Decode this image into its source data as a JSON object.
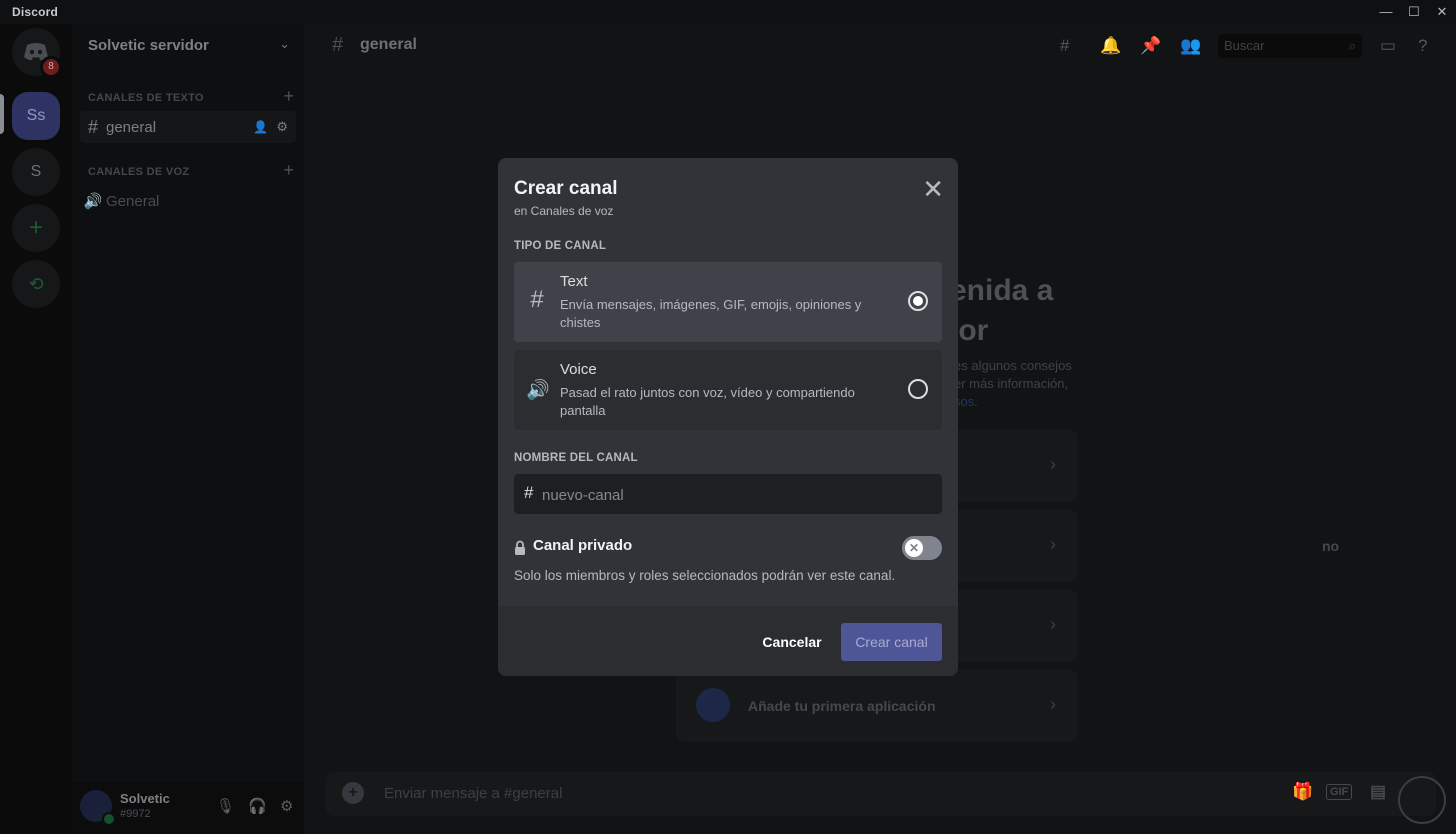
{
  "window": {
    "app_name": "Discord",
    "controls": [
      "—",
      "☐",
      "✕"
    ]
  },
  "guilds": [
    {
      "label": "",
      "badge": "8"
    },
    {
      "label": "Ss"
    },
    {
      "label": "S"
    },
    {
      "label": "+"
    },
    {
      "label": "⟲"
    }
  ],
  "sidebar": {
    "server_name": "Solvetic servidor",
    "text_category": "CANALES DE TEXTO",
    "voice_category": "CANALES DE VOZ",
    "text_channel": "general",
    "voice_channel": "General"
  },
  "user": {
    "name": "Solvetic",
    "tag": "#9972"
  },
  "topbar": {
    "channel": "general",
    "search_placeholder": "Buscar"
  },
  "welcome": {
    "line1": "enida a",
    "line2": "lor",
    "desc1": "es algunos consejos",
    "desc2": "er más información,",
    "desc3": "sos."
  },
  "cards": [
    {
      "label": ""
    },
    {
      "label": "no"
    },
    {
      "label": ""
    },
    {
      "label": "Añade tu primera aplicación"
    }
  ],
  "composer": {
    "placeholder": "Enviar mensaje a #general",
    "gif": "GIF"
  },
  "modal": {
    "title": "Crear canal",
    "subtitle": "en Canales de voz",
    "type_label": "TIPO DE CANAL",
    "options": [
      {
        "title": "Text",
        "desc": "Envía mensajes, imágenes, GIF, emojis, opiniones y chistes",
        "selected": true
      },
      {
        "title": "Voice",
        "desc": "Pasad el rato juntos con voz, vídeo y compartiendo pantalla",
        "selected": false
      }
    ],
    "name_label": "NOMBRE DEL CANAL",
    "name_placeholder": "nuevo-canal",
    "private_label": "Canal privado",
    "private_desc": "Solo los miembros y roles seleccionados podrán ver este canal.",
    "private_enabled": false,
    "cancel": "Cancelar",
    "create": "Crear canal"
  },
  "colors": {
    "accent": "#5865f2",
    "modal_bg": "#313338",
    "create_button_disabled": "#4e5698"
  }
}
